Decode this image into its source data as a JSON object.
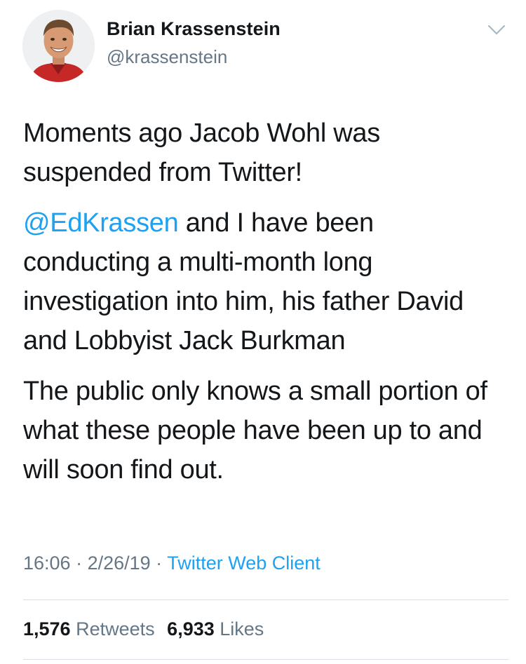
{
  "colors": {
    "link": "#1da1f2",
    "secondary_text": "#657786",
    "primary_text": "#14171a",
    "divider": "#d8dee3"
  },
  "author": {
    "avatar_icon": "profile-photo",
    "display_name": "Brian Krassenstein",
    "handle": "@krassenstein",
    "menu_icon": "chevron-down-icon"
  },
  "tweet": {
    "paragraph1": "Moments ago Jacob Wohl was suspended from Twitter!",
    "mention": "@EdKrassen",
    "paragraph2_rest": " and I have been conducting a multi-month long investigation into him, his father David and Lobbyist Jack Burkman",
    "paragraph3": "The public only knows a small portion of what these people have been up to and will soon find out."
  },
  "meta": {
    "time": "16:06",
    "separator": " · ",
    "date": "2/26/19",
    "client": "Twitter Web Client"
  },
  "stats": {
    "retweets_count": "1,576",
    "retweets_label": "Retweets",
    "likes_count": "6,933",
    "likes_label": "Likes"
  }
}
